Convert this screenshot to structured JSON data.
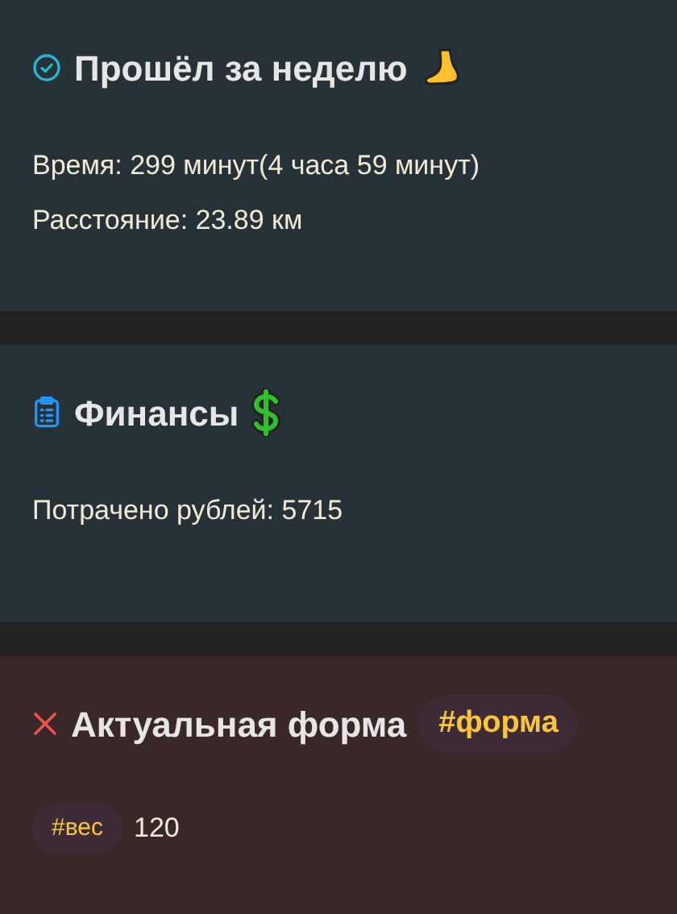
{
  "callouts": [
    {
      "kind": "success",
      "title": "Прошёл за неделю",
      "lines": [
        [
          {
            "kind": "text",
            "text": "Время: 299 минут(4 часа 59 минут)"
          }
        ],
        [
          {
            "kind": "text",
            "text": "Расстояние: 23.89 км"
          }
        ]
      ]
    },
    {
      "kind": "info",
      "title": "Финансы",
      "lines": [
        [
          {
            "kind": "text",
            "text": "Потрачено рублей: 5715"
          }
        ]
      ]
    },
    {
      "kind": "failure",
      "title": "Актуальная форма",
      "title_tag": "#форма",
      "lines": [
        [
          {
            "kind": "tag",
            "text": "#вес"
          },
          {
            "kind": "text",
            "text": "120"
          }
        ]
      ]
    }
  ]
}
